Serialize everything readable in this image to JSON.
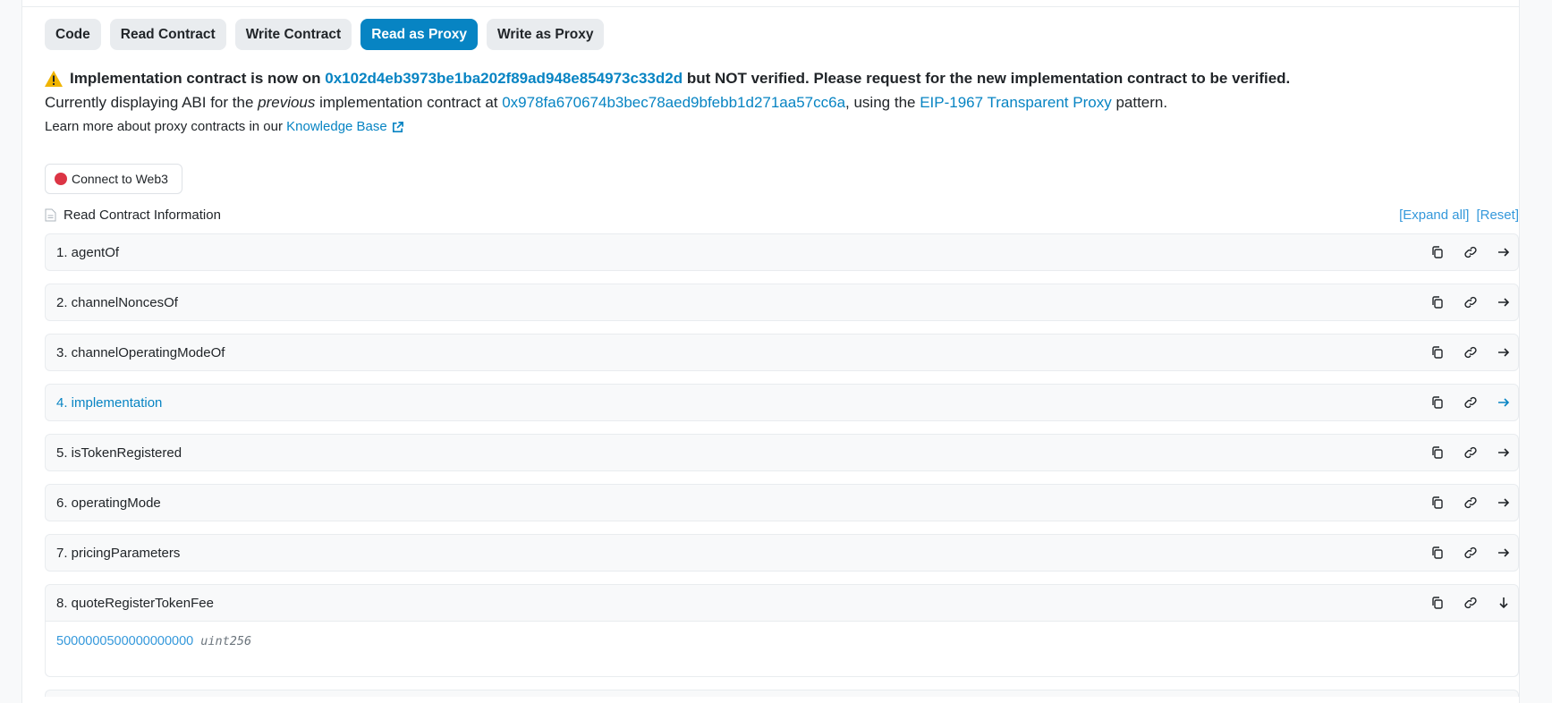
{
  "tabs": [
    {
      "label": "Code",
      "active": false
    },
    {
      "label": "Read Contract",
      "active": false
    },
    {
      "label": "Write Contract",
      "active": false
    },
    {
      "label": "Read as Proxy",
      "active": true
    },
    {
      "label": "Write as Proxy",
      "active": false
    }
  ],
  "notice": {
    "line1_prefix": "Implementation contract is now on ",
    "new_impl_address": "0x102d4eb3973be1ba202f89ad948e854973c33d2d",
    "line1_suffix": " but NOT verified. Please request for the new implementation contract to be verified.",
    "line2_prefix": "Currently displaying ABI for the ",
    "line2_em": "previous",
    "line2_mid": " implementation contract at ",
    "prev_impl_address": "0x978fa670674b3bec78aed9bfebb1d271aa57cc6a",
    "line2_mid2": ", using the ",
    "proxy_pattern_link": "EIP-1967 Transparent Proxy",
    "line2_suffix": " pattern.",
    "line3_prefix": "Learn more about proxy contracts in our ",
    "kb_link": "Knowledge Base"
  },
  "connect_label": "Connect to Web3",
  "read_info_label": "Read Contract Information",
  "expand_all": "[Expand all]",
  "reset": "[Reset]",
  "functions": [
    {
      "label": "1. agentOf"
    },
    {
      "label": "2. channelNoncesOf"
    },
    {
      "label": "3. channelOperatingModeOf"
    },
    {
      "label": "4. implementation"
    },
    {
      "label": "5. isTokenRegistered"
    },
    {
      "label": "6. operatingMode"
    },
    {
      "label": "7. pricingParameters"
    },
    {
      "label": "8. quoteRegisterTokenFee",
      "result_value": "5000000500000000000",
      "result_type": "uint256"
    }
  ],
  "icons": {
    "warning": "warning-triangle-icon",
    "copy": "copy-icon",
    "link": "link-icon",
    "arrow": "arrow-right-icon",
    "arrow_down": "arrow-down-icon",
    "doc": "document-icon",
    "external": "external-link-icon"
  },
  "colors": {
    "accent": "#0784c3",
    "link": "#3498db",
    "danger": "#dc3545",
    "warning": "#f0b400"
  }
}
